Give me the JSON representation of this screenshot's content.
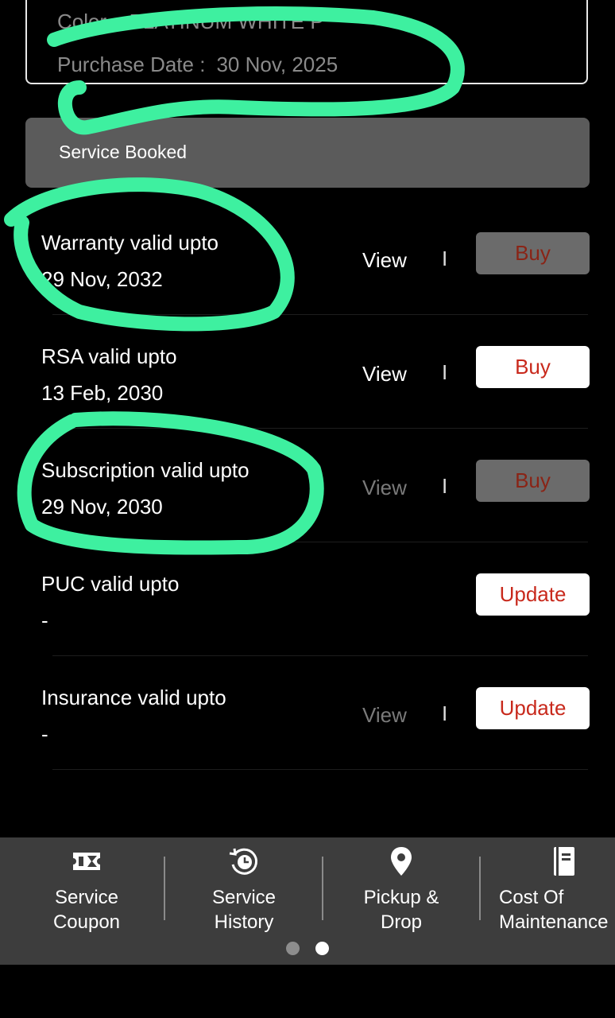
{
  "vehicle": {
    "color_label": "Color :",
    "color_value": "PLATINUM WHITE P",
    "purchase_label": "Purchase Date :",
    "purchase_value": "30 Nov, 2025"
  },
  "service_banner": {
    "text": "Service Booked"
  },
  "validity_rows": [
    {
      "title": "Warranty valid upto",
      "date": "29 Nov, 2032",
      "view_label": "View",
      "separator": "I",
      "action_label": "Buy"
    },
    {
      "title": "RSA valid upto",
      "date": "13 Feb, 2030",
      "view_label": "View",
      "separator": "I",
      "action_label": "Buy"
    },
    {
      "title": "Subscription valid upto",
      "date": "29 Nov, 2030",
      "view_label": "View",
      "separator": "I",
      "action_label": "Buy"
    },
    {
      "title": "PUC valid upto",
      "date": "-",
      "action_label": "Update"
    },
    {
      "title": "Insurance valid upto",
      "date": "-",
      "view_label": "View",
      "separator": "I",
      "action_label": "Update"
    }
  ],
  "bottom_nav": {
    "items": [
      {
        "label": "Service\nCoupon",
        "icon": "coupon-icon"
      },
      {
        "label": "Service\nHistory",
        "icon": "history-icon"
      },
      {
        "label": "Pickup &\nDrop",
        "icon": "location-pin-icon"
      },
      {
        "label": "Cost Of\nMaintenance",
        "icon": "document-icon"
      }
    ],
    "page_count": 2,
    "active_page": 2
  },
  "colors": {
    "background": "#000000",
    "banner": "#5b5b5b",
    "action_text": "#c8291c",
    "nav_background": "#3d3d3d",
    "annotation": "#3ef0a0"
  }
}
